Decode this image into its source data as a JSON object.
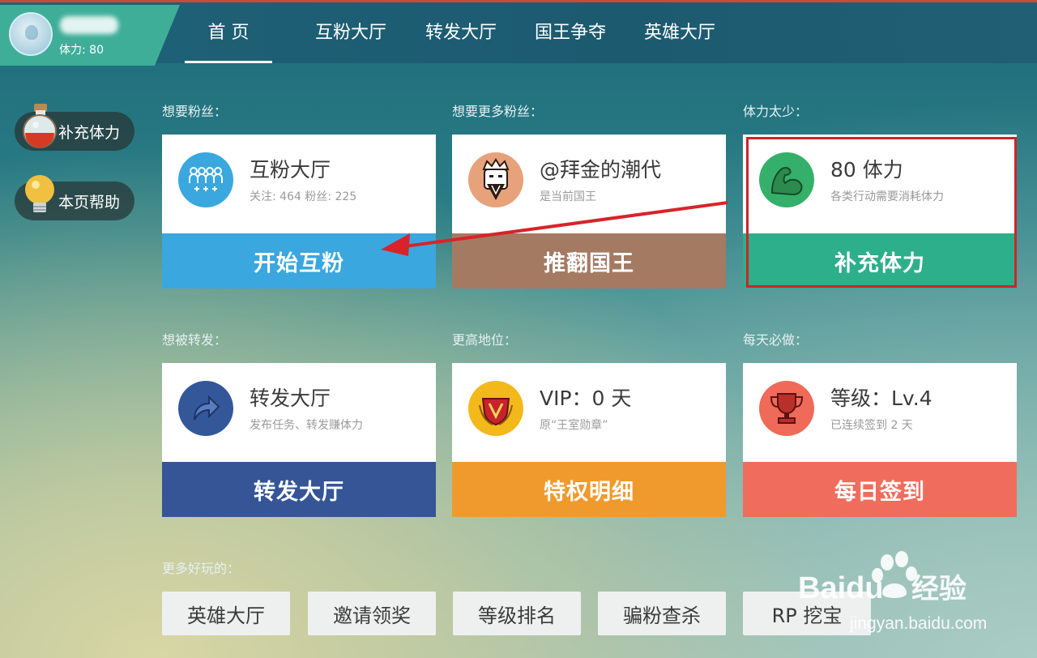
{
  "header": {
    "stamina_text": "体力: 80",
    "nav": [
      "首 页",
      "互粉大厅",
      "转发大厅",
      "国王争夺",
      "英雄大厅"
    ],
    "active_nav": "首 页"
  },
  "sidebar": {
    "buttons": [
      {
        "label": "补充体力",
        "icon": "potion-icon"
      },
      {
        "label": "本页帮助",
        "icon": "lightbulb-icon"
      }
    ]
  },
  "sections": [
    {
      "label": "想要粉丝：",
      "title": "互粉大厅",
      "sub": "关注: 464  粉丝: 225",
      "button": "开始互粉",
      "color": "#3aa7df",
      "icon": "fans-group-icon",
      "icon_bg": "#3aa7df"
    },
    {
      "label": "想要更多粉丝：",
      "title": "@拜金的潮代",
      "sub": "是当前国王",
      "button": "推翻国王",
      "color": "#a57a63",
      "icon": "king-icon",
      "icon_bg": "#e7a27b"
    },
    {
      "label": "体力太少：",
      "title": "80 体力",
      "sub": "各类行动需要消耗体力",
      "button": "补充体力",
      "color": "#2eaf8b",
      "icon": "muscle-arm-icon",
      "icon_bg": "#35b06a"
    },
    {
      "label": "想被转发：",
      "title": "转发大厅",
      "sub": "发布任务、转发赚体力",
      "button": "转发大厅",
      "color": "#355596",
      "icon": "share-arrow-icon",
      "icon_bg": "#34579a"
    },
    {
      "label": "更高地位：",
      "title": "VIP：0 天",
      "sub": "原“王室勋章”",
      "button": "特权明细",
      "color": "#f09a2e",
      "icon": "vip-shield-icon",
      "icon_bg": "#f3b81a"
    },
    {
      "label": "每天必做：",
      "title": "等级：Lv.4",
      "sub": "已连续签到 2 天",
      "button": "每日签到",
      "color": "#f06d5e",
      "icon": "trophy-icon",
      "icon_bg": "#ef6a59"
    }
  ],
  "more": {
    "label": "更多好玩的：",
    "buttons": [
      "英雄大厅",
      "邀请领奖",
      "等级排名",
      "骗粉查杀",
      "RP 挖宝"
    ]
  },
  "watermark": {
    "brand": "Baidu",
    "cn": "经验",
    "url": "jingyan.baidu.com"
  }
}
